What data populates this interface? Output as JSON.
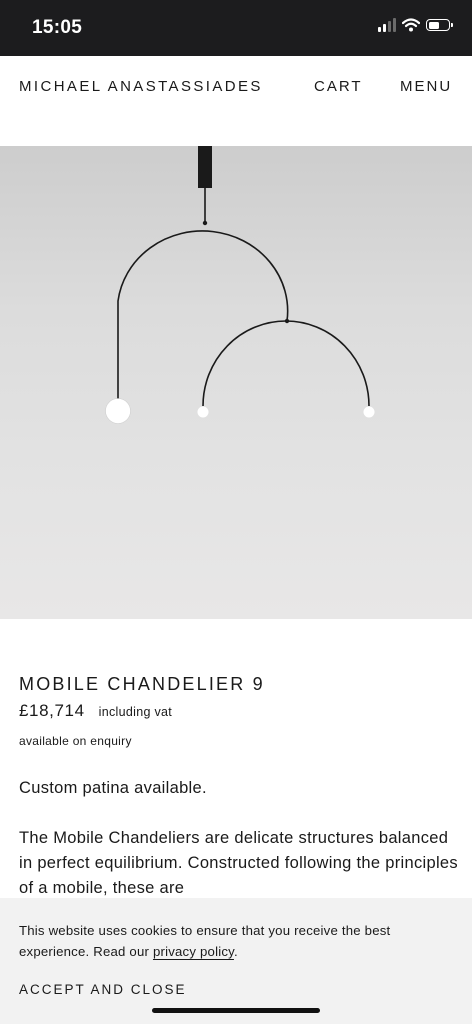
{
  "status_bar": {
    "time": "15:05",
    "icons": [
      "cellular-signal-icon",
      "wifi-icon",
      "battery-icon"
    ]
  },
  "header": {
    "brand": "MICHAEL ANASTASSIADES",
    "cart_label": "CART",
    "menu_label": "MENU"
  },
  "product": {
    "image_subject": "mobile-chandelier-icon",
    "title": "MOBILE CHANDELIER 9",
    "price": "£18,714",
    "vat_note": "including vat",
    "availability": "available on enquiry",
    "patina_note": "Custom patina available.",
    "description": "The Mobile Chandeliers are delicate structures balanced in perfect equilibrium. Constructed following the principles of a mobile, these are"
  },
  "cookie_banner": {
    "text_before_link": "This website uses cookies to ensure that you receive the best experience. Read our ",
    "link_text": "privacy policy",
    "text_after_link": ".",
    "accept_label": "ACCEPT AND CLOSE"
  },
  "colors": {
    "status_bar_bg": "#1c1c1e",
    "page_bg": "#ffffff",
    "text": "#1a1a1a",
    "cookie_bg": "#f2f2f2",
    "image_bg": "#dcdcdc"
  }
}
